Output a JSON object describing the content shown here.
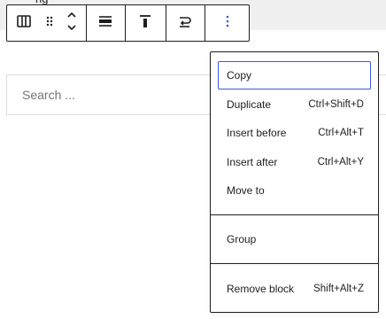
{
  "page": {
    "top_strip_text": "ng"
  },
  "toolbar": {
    "column_icon": "columns-icon",
    "drag_icon": "drag-handle-icon",
    "move_icon": "move-up-down-icon",
    "align_icon": "align-center-icon",
    "valign_icon": "vertical-align-top-icon",
    "transform_icon": "transform-icon",
    "options_icon": "more-vertical-icon"
  },
  "search": {
    "placeholder": "Search ..."
  },
  "menu": {
    "group1": [
      {
        "label": "Copy",
        "shortcut": ""
      },
      {
        "label": "Duplicate",
        "shortcut": "Ctrl+Shift+D"
      },
      {
        "label": "Insert before",
        "shortcut": "Ctrl+Alt+T"
      },
      {
        "label": "Insert after",
        "shortcut": "Ctrl+Alt+Y"
      },
      {
        "label": "Move to",
        "shortcut": ""
      }
    ],
    "group2": [
      {
        "label": "Group",
        "shortcut": ""
      }
    ],
    "group3": [
      {
        "label": "Remove block",
        "shortcut": "Shift+Alt+Z"
      }
    ]
  },
  "colors": {
    "focus": "#3858e9",
    "border": "#1e1e1e",
    "muted": "#757575"
  }
}
